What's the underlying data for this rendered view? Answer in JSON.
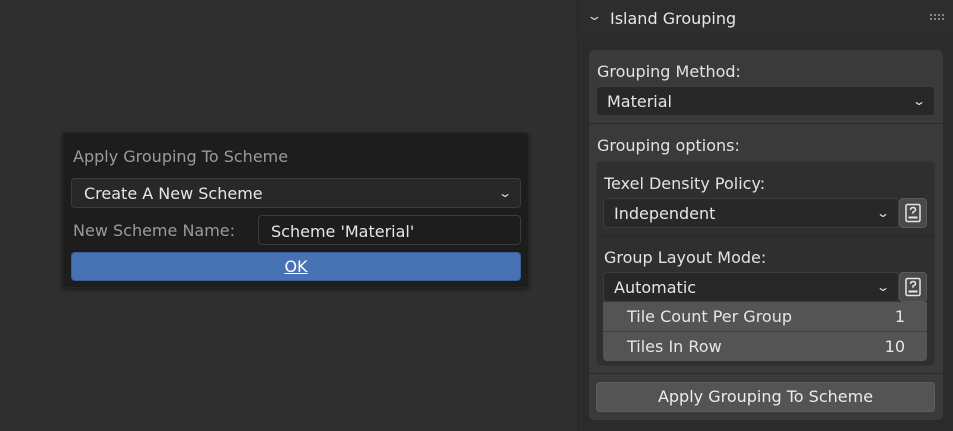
{
  "dialog": {
    "title": "Apply Grouping To Scheme",
    "scheme_dropdown": "Create A New Scheme",
    "name_label": "New Scheme Name:",
    "name_value": "Scheme 'Material'",
    "ok_label": "OK"
  },
  "panel": {
    "title": "Island Grouping",
    "grouping_method_label": "Grouping Method:",
    "grouping_method_value": "Material",
    "grouping_options_label": "Grouping options:",
    "texel_density_label": "Texel Density Policy:",
    "texel_density_value": "Independent",
    "group_layout_label": "Group Layout Mode:",
    "group_layout_value": "Automatic",
    "tile_count_label": "Tile Count Per Group",
    "tile_count_value": "1",
    "tiles_in_row_label": "Tiles In Row",
    "tiles_in_row_value": "10",
    "apply_button_label": "Apply Grouping To Scheme"
  },
  "icons": {
    "dropdown": "chevron-down-icon",
    "panel_collapse": "chevron-down-icon",
    "drag": "grip-icon",
    "help": "help-book-icon"
  },
  "colors": {
    "accent": "#4772b3",
    "background": "#303030",
    "panel": "#2b2b2b"
  }
}
